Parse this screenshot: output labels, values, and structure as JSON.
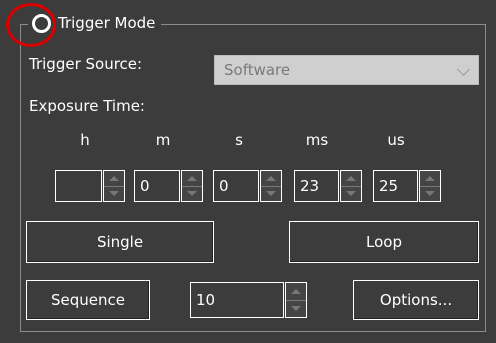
{
  "group": {
    "title": "Trigger Mode"
  },
  "trigger_source": {
    "label": "Trigger Source:",
    "value": "Software"
  },
  "exposure": {
    "label": "Exposure Time:",
    "units": [
      "h",
      "m",
      "s",
      "ms",
      "us"
    ],
    "values": [
      "",
      "0",
      "0",
      "23",
      "25"
    ]
  },
  "buttons": {
    "single": "Single",
    "loop": "Loop",
    "sequence": "Sequence",
    "options": "Options..."
  },
  "sequence_count": "10",
  "colors": {
    "background": "#3c3c3c",
    "highlight": "#d80000",
    "text": "#ffffff"
  },
  "icons": [
    "radio-icon",
    "chevron-down-icon",
    "spin-up-icon",
    "spin-down-icon"
  ]
}
